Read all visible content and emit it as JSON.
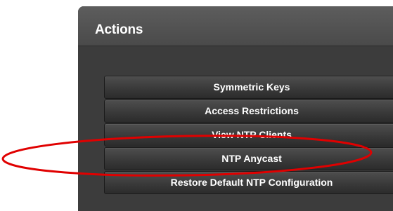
{
  "panel": {
    "title": "Actions"
  },
  "actions": [
    {
      "label": "Symmetric Keys"
    },
    {
      "label": "Access Restrictions"
    },
    {
      "label": "View NTP Clients"
    },
    {
      "label": "NTP Anycast"
    },
    {
      "label": "Restore Default NTP Configuration"
    }
  ],
  "colors": {
    "panel_bg": "#3c3c3c",
    "header_bg": "#4f4f4f",
    "button_text": "#ffffff",
    "annotation": "#e00000"
  },
  "annotation": {
    "shape": "ellipse",
    "highlights": "NTP Anycast"
  }
}
